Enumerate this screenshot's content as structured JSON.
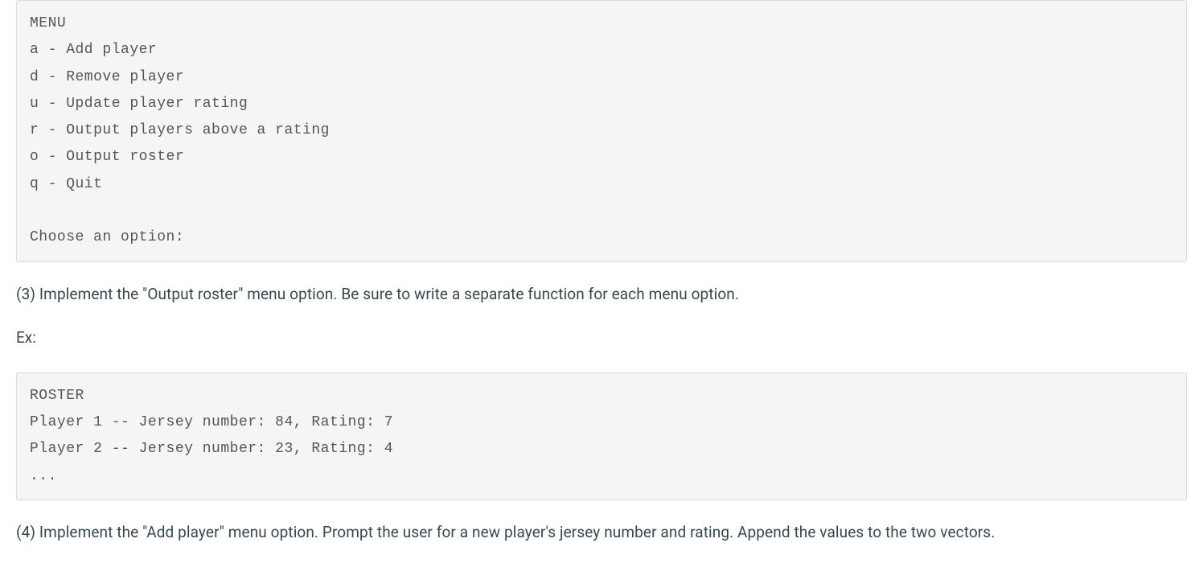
{
  "menu_block": {
    "title": "MENU",
    "options": [
      "a - Add player",
      "d - Remove player",
      "u - Update player rating",
      "r - Output players above a rating",
      "o - Output roster",
      "q - Quit"
    ],
    "prompt": "Choose an option:"
  },
  "instruction_3": "(3) Implement the \"Output roster\" menu option. Be sure to write a separate function for each menu option.",
  "ex_label": "Ex:",
  "roster_block": {
    "title": "ROSTER",
    "lines": [
      "Player 1 -- Jersey number: 84, Rating: 7",
      "Player 2 -- Jersey number: 23, Rating: 4",
      "..."
    ]
  },
  "instruction_4": "(4) Implement the \"Add player\" menu option. Prompt the user for a new player's jersey number and rating. Append the values to the two vectors."
}
